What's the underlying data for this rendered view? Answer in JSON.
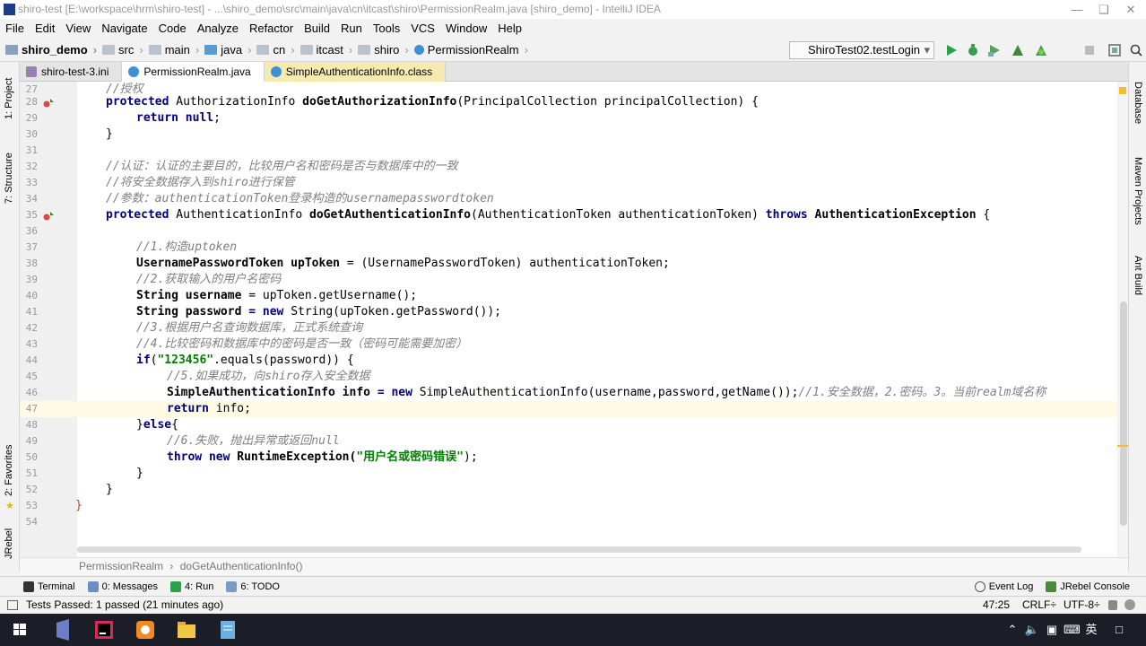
{
  "title_bar": {
    "text": "shiro-test [E:\\workspace\\hrm\\shiro-test] - ...\\shiro_demo\\src\\main\\java\\cn\\itcast\\shiro\\PermissionRealm.java [shiro_demo] - IntelliJ IDEA"
  },
  "menu": [
    "File",
    "Edit",
    "View",
    "Navigate",
    "Code",
    "Analyze",
    "Refactor",
    "Build",
    "Run",
    "Tools",
    "VCS",
    "Window",
    "Help"
  ],
  "breadcrumbs": [
    "shiro_demo",
    "src",
    "main",
    "java",
    "cn",
    "itcast",
    "shiro",
    "PermissionRealm"
  ],
  "run_config": "ShiroTest02.testLogin",
  "tabs": [
    "shiro-test-3.ini",
    "PermissionRealm.java",
    "SimpleAuthenticationInfo.class"
  ],
  "left_tools": [
    "1: Project",
    "7: Structure",
    "2: Favorites",
    "JRebel"
  ],
  "right_tools": [
    "Database",
    "Maven Projects",
    "Ant Build"
  ],
  "code": {
    "line_numbers": [
      "27",
      "28",
      "29",
      "30",
      "31",
      "32",
      "33",
      "34",
      "35",
      "36",
      "37",
      "38",
      "39",
      "40",
      "41",
      "42",
      "43",
      "44",
      "45",
      "46",
      "47",
      "48",
      "49",
      "50",
      "51",
      "52",
      "53",
      "54"
    ],
    "l27": "//授权",
    "l28_kw": "protected ",
    "l28_type": "AuthorizationInfo ",
    "l28_method": "doGetAuthorizationInfo",
    "l28_rest": "(PrincipalCollection principalCollection) {",
    "l29_kw": "return null",
    "l29_rest": ";",
    "l30": "}",
    "l32": "//认证：认证的主要目的，比较用户名和密码是否与数据库中的一致",
    "l33": "//将安全数据存入到shiro进行保管",
    "l34": "//参数：authenticationToken登录构造的usernamepasswordtoken",
    "l35_kw": "protected ",
    "l35_type": "AuthenticationInfo ",
    "l35_method": "doGetAuthenticationInfo",
    "l35_rest": "(AuthenticationToken authenticationToken) ",
    "l35_kw2": "throws ",
    "l35_exc": "AuthenticationException",
    "l35_end": " {",
    "l37": "//1.构造uptoken",
    "l38_a": "UsernamePasswordToken upToken ",
    "l38_b": "= (UsernamePasswordToken) authenticationToken;",
    "l39": "//2.获取输入的用户名密码",
    "l40_a": "String username ",
    "l40_b": "= upToken.getUsername();",
    "l41_a": "String password ",
    "l41_kw": "= new ",
    "l41_b": "String(upToken.getPassword());",
    "l42": "//3.根据用户名查询数据库，正式系统查询",
    "l43": "//4.比较密码和数据库中的密码是否一致（密码可能需要加密）",
    "l44_kw": "if",
    "l44_a": "(",
    "l44_str": "\"123456\"",
    "l44_b": ".equals(password)) {",
    "l45": "//5.如果成功，向shiro存入安全数据",
    "l46_a": "SimpleAuthenticationInfo info ",
    "l46_kw": "= new ",
    "l46_b": "SimpleAuthenticationInfo(username,password,getName());",
    "l46_cm": "//1.安全数据，2.密码。3。当前realm域名称",
    "l47_kw": "return ",
    "l47_b": "info;",
    "l48_a": "}",
    "l48_kw": "else",
    "l48_b": "{",
    "l49": "//6.失败，抛出异常或返回null",
    "l50_kw": "throw new ",
    "l50_a": "RuntimeException(",
    "l50_str": "\"用户名或密码错误\"",
    "l50_b": ");",
    "l51": "}",
    "l52": "}",
    "l53": "}"
  },
  "bottom_breadcrumb": [
    "PermissionRealm",
    "doGetAuthenticationInfo()"
  ],
  "tool_windows": [
    "Terminal",
    "0: Messages",
    "4: Run",
    "6: TODO"
  ],
  "tool_windows_right": [
    "Event Log",
    "JRebel Console"
  ],
  "status": {
    "message": "Tests Passed: 1 passed (21 minutes ago)",
    "position": "47:25",
    "line_sep": "CRLF÷",
    "encoding": "UTF-8÷"
  },
  "taskbar": {
    "ime": "英",
    "colors": {
      "bg": "#1b1e26"
    }
  }
}
